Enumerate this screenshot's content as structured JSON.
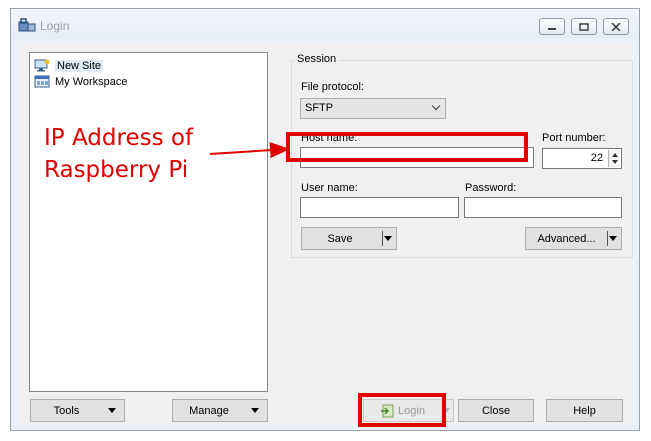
{
  "window": {
    "title": "Login",
    "icon": "winscp-login-icon",
    "controls": [
      "minimize-icon",
      "restore-icon",
      "close-icon"
    ]
  },
  "sites": {
    "items": [
      {
        "label": "New Site",
        "icon": "new-site-computer-icon",
        "selected": true
      },
      {
        "label": "My Workspace",
        "icon": "workspace-icon",
        "selected": false
      }
    ]
  },
  "session": {
    "group_label": "Session",
    "file_protocol_label": "File protocol:",
    "file_protocol_value": "SFTP",
    "host_label": "Host name:",
    "host_value": "",
    "port_label": "Port number:",
    "port_value": "22",
    "user_label": "User name:",
    "user_value": "",
    "password_label": "Password:",
    "password_value": "",
    "save_label": "Save",
    "advanced_label": "Advanced..."
  },
  "bottom": {
    "tools_label": "Tools",
    "manage_label": "Manage",
    "login_label": "Login",
    "close_label": "Close",
    "help_label": "Help"
  },
  "annotation": {
    "text_line1": "IP Address of",
    "text_line2": "Raspberry Pi",
    "color": "#e00000"
  }
}
